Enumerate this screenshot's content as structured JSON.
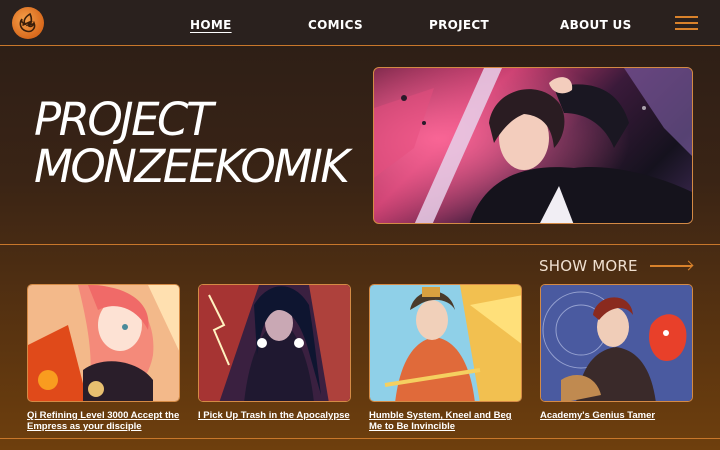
{
  "nav": {
    "logo_icon": "flame-logo-icon",
    "links": [
      {
        "label": "HOME",
        "active": true
      },
      {
        "label": "COMICS",
        "active": false
      },
      {
        "label": "PROJECT",
        "active": false
      },
      {
        "label": "ABOUT US",
        "active": false
      }
    ],
    "menu_icon": "hamburger-menu-icon"
  },
  "hero": {
    "title_line1": "PROJECT",
    "title_line2": "MONZEEKOMIK",
    "image_alt": "manga-character-with-sword"
  },
  "section": {
    "show_more_label": "SHOW MORE",
    "show_more_icon": "arrow-right-icon"
  },
  "comics": [
    {
      "title": "Qi Refining Level 3000 Accept the Empress as your disciple"
    },
    {
      "title": "I Pick Up Trash in the Apocalypse"
    },
    {
      "title": "Humble System, Kneel and Beg Me to Be Invincible"
    },
    {
      "title": "Academy's Genius Tamer"
    }
  ],
  "colors": {
    "accent": "#d9822b",
    "topbar": "#2a211e",
    "background_top": "#2a1d17",
    "background_bottom": "#6e3f0d"
  }
}
